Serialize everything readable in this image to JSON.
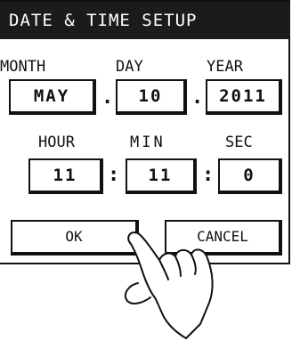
{
  "title": "DATE & TIME SETUP",
  "date": {
    "month": {
      "label": "MONTH",
      "value": "MAY"
    },
    "day": {
      "label": "DAY",
      "value": "10"
    },
    "year": {
      "label": "YEAR",
      "value": "2011"
    },
    "separator": "."
  },
  "time": {
    "hour": {
      "label": "HOUR",
      "value": "11"
    },
    "min": {
      "label": "MIN",
      "value": "11"
    },
    "sec": {
      "label": "SEC",
      "value": "0"
    },
    "separator": ":"
  },
  "buttons": {
    "ok": "OK",
    "cancel": "CANCEL"
  },
  "icons": {
    "pointer": "hand-pointer-icon"
  }
}
